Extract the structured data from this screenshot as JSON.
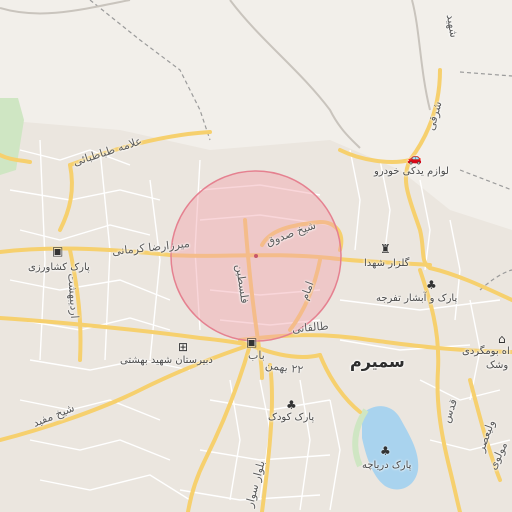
{
  "map": {
    "city_label": "سمیرم",
    "accent_circle_color": "#f2a3ad",
    "colors": {
      "background": "#f2efea",
      "main_road": "#f6d06e",
      "minor_road": "#ffffff",
      "water": "#a9d3ee",
      "park": "#cfe6c3",
      "dashed_boundary": "#9b9b9b"
    },
    "labels": {
      "road_allameh": "علامه طباطبائی",
      "road_mirza_reza": "میرزارضا کرمانی",
      "road_sheikh_sadough": "شیخ صدوق",
      "road_felestin": "فلسطین",
      "road_ordibehesht": "اردیبهشت",
      "road_sheikh_mofid": "شیخ مفید",
      "road_emam": "امام",
      "road_taleghani": "طالقانی",
      "road_22_bahman": "۲۲ بهمن",
      "road_bab": "باب",
      "road_quds": "قدس",
      "road_valiasr": "ولیعصر",
      "road_molavi": "مولوی",
      "road_shahid": "شهید",
      "road_sharghi": "شرقی",
      "road_avazar": "بلوار سوار",
      "poi_lavazem": "لوازم یدکی خودرو",
      "poi_golzar": "گلزار شهدا",
      "poi_park_keshavarzi": "پارک کشاورزی",
      "poi_dabirestan": "دبیرستان شهید بهشتی",
      "poi_park_abshar": "پارک و آبشار تفرجه",
      "poi_park_koodak": "پارک کودک",
      "poi_park_daryache": "پارک دریاچه",
      "poi_bomgardi": "اه بومگردی",
      "poi_koushk": "وشک"
    },
    "icons": {
      "car_icon": "car-repair-icon",
      "monument_icon": "monument-icon",
      "park_icon": "tree-icon",
      "school_icon": "school-icon",
      "hotel_icon": "hotel-icon",
      "bus_icon": "bus-icon"
    }
  }
}
